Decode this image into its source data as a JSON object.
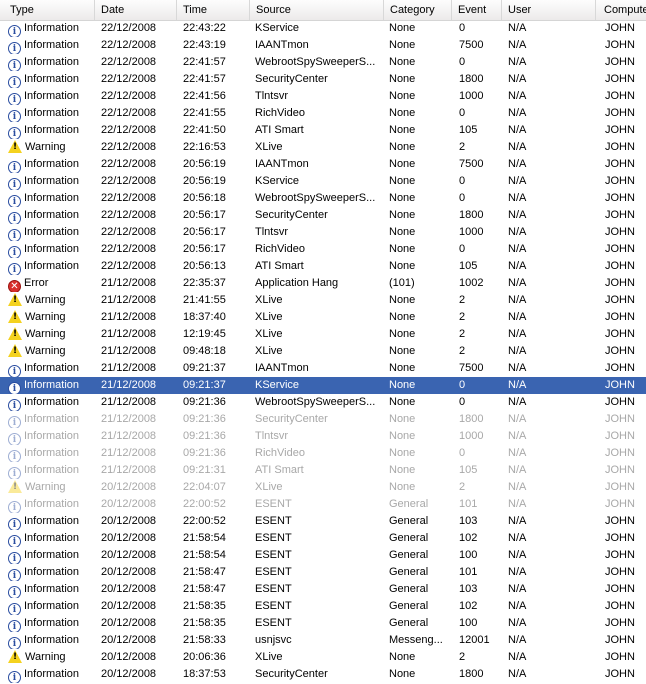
{
  "columns": {
    "type": "Type",
    "date": "Date",
    "time": "Time",
    "source": "Source",
    "category": "Category",
    "event": "Event",
    "user": "User",
    "computer": "Computer"
  },
  "icons": {
    "Information": {
      "name": "information-icon",
      "glyph": "i"
    },
    "Warning": {
      "name": "warning-icon",
      "glyph": "!"
    },
    "Error": {
      "name": "error-icon",
      "glyph": "✕"
    }
  },
  "colors": {
    "selection": "#3a64b1",
    "info_icon": "#2a4da0",
    "warning_icon": "#f4d21f",
    "error_icon": "#d8302c"
  },
  "selected_row": 21,
  "faded_rows": [
    23,
    24,
    25,
    26,
    27,
    28
  ],
  "rows": [
    {
      "type": "Information",
      "date": "22/12/2008",
      "time": "22:43:22",
      "source": "KService",
      "category": "None",
      "event": "0",
      "user": "N/A",
      "computer": "JOHN"
    },
    {
      "type": "Information",
      "date": "22/12/2008",
      "time": "22:43:19",
      "source": "IAANTmon",
      "category": "None",
      "event": "7500",
      "user": "N/A",
      "computer": "JOHN"
    },
    {
      "type": "Information",
      "date": "22/12/2008",
      "time": "22:41:57",
      "source": "WebrootSpySweeperS...",
      "category": "None",
      "event": "0",
      "user": "N/A",
      "computer": "JOHN"
    },
    {
      "type": "Information",
      "date": "22/12/2008",
      "time": "22:41:57",
      "source": "SecurityCenter",
      "category": "None",
      "event": "1800",
      "user": "N/A",
      "computer": "JOHN"
    },
    {
      "type": "Information",
      "date": "22/12/2008",
      "time": "22:41:56",
      "source": "Tlntsvr",
      "category": "None",
      "event": "1000",
      "user": "N/A",
      "computer": "JOHN"
    },
    {
      "type": "Information",
      "date": "22/12/2008",
      "time": "22:41:55",
      "source": "RichVideo",
      "category": "None",
      "event": "0",
      "user": "N/A",
      "computer": "JOHN"
    },
    {
      "type": "Information",
      "date": "22/12/2008",
      "time": "22:41:50",
      "source": "ATI Smart",
      "category": "None",
      "event": "105",
      "user": "N/A",
      "computer": "JOHN"
    },
    {
      "type": "Warning",
      "date": "22/12/2008",
      "time": "22:16:53",
      "source": "XLive",
      "category": "None",
      "event": "2",
      "user": "N/A",
      "computer": "JOHN"
    },
    {
      "type": "Information",
      "date": "22/12/2008",
      "time": "20:56:19",
      "source": "IAANTmon",
      "category": "None",
      "event": "7500",
      "user": "N/A",
      "computer": "JOHN"
    },
    {
      "type": "Information",
      "date": "22/12/2008",
      "time": "20:56:19",
      "source": "KService",
      "category": "None",
      "event": "0",
      "user": "N/A",
      "computer": "JOHN"
    },
    {
      "type": "Information",
      "date": "22/12/2008",
      "time": "20:56:18",
      "source": "WebrootSpySweeperS...",
      "category": "None",
      "event": "0",
      "user": "N/A",
      "computer": "JOHN"
    },
    {
      "type": "Information",
      "date": "22/12/2008",
      "time": "20:56:17",
      "source": "SecurityCenter",
      "category": "None",
      "event": "1800",
      "user": "N/A",
      "computer": "JOHN"
    },
    {
      "type": "Information",
      "date": "22/12/2008",
      "time": "20:56:17",
      "source": "Tlntsvr",
      "category": "None",
      "event": "1000",
      "user": "N/A",
      "computer": "JOHN"
    },
    {
      "type": "Information",
      "date": "22/12/2008",
      "time": "20:56:17",
      "source": "RichVideo",
      "category": "None",
      "event": "0",
      "user": "N/A",
      "computer": "JOHN"
    },
    {
      "type": "Information",
      "date": "22/12/2008",
      "time": "20:56:13",
      "source": "ATI Smart",
      "category": "None",
      "event": "105",
      "user": "N/A",
      "computer": "JOHN"
    },
    {
      "type": "Error",
      "date": "21/12/2008",
      "time": "22:35:37",
      "source": "Application Hang",
      "category": "(101)",
      "event": "1002",
      "user": "N/A",
      "computer": "JOHN"
    },
    {
      "type": "Warning",
      "date": "21/12/2008",
      "time": "21:41:55",
      "source": "XLive",
      "category": "None",
      "event": "2",
      "user": "N/A",
      "computer": "JOHN"
    },
    {
      "type": "Warning",
      "date": "21/12/2008",
      "time": "18:37:40",
      "source": "XLive",
      "category": "None",
      "event": "2",
      "user": "N/A",
      "computer": "JOHN"
    },
    {
      "type": "Warning",
      "date": "21/12/2008",
      "time": "12:19:45",
      "source": "XLive",
      "category": "None",
      "event": "2",
      "user": "N/A",
      "computer": "JOHN"
    },
    {
      "type": "Warning",
      "date": "21/12/2008",
      "time": "09:48:18",
      "source": "XLive",
      "category": "None",
      "event": "2",
      "user": "N/A",
      "computer": "JOHN"
    },
    {
      "type": "Information",
      "date": "21/12/2008",
      "time": "09:21:37",
      "source": "IAANTmon",
      "category": "None",
      "event": "7500",
      "user": "N/A",
      "computer": "JOHN"
    },
    {
      "type": "Information",
      "date": "21/12/2008",
      "time": "09:21:37",
      "source": "KService",
      "category": "None",
      "event": "0",
      "user": "N/A",
      "computer": "JOHN"
    },
    {
      "type": "Information",
      "date": "21/12/2008",
      "time": "09:21:36",
      "source": "WebrootSpySweeperS...",
      "category": "None",
      "event": "0",
      "user": "N/A",
      "computer": "JOHN"
    },
    {
      "type": "Information",
      "date": "21/12/2008",
      "time": "09:21:36",
      "source": "SecurityCenter",
      "category": "None",
      "event": "1800",
      "user": "N/A",
      "computer": "JOHN"
    },
    {
      "type": "Information",
      "date": "21/12/2008",
      "time": "09:21:36",
      "source": "Tlntsvr",
      "category": "None",
      "event": "1000",
      "user": "N/A",
      "computer": "JOHN"
    },
    {
      "type": "Information",
      "date": "21/12/2008",
      "time": "09:21:36",
      "source": "RichVideo",
      "category": "None",
      "event": "0",
      "user": "N/A",
      "computer": "JOHN"
    },
    {
      "type": "Information",
      "date": "21/12/2008",
      "time": "09:21:31",
      "source": "ATI Smart",
      "category": "None",
      "event": "105",
      "user": "N/A",
      "computer": "JOHN"
    },
    {
      "type": "Warning",
      "date": "20/12/2008",
      "time": "22:04:07",
      "source": "XLive",
      "category": "None",
      "event": "2",
      "user": "N/A",
      "computer": "JOHN"
    },
    {
      "type": "Information",
      "date": "20/12/2008",
      "time": "22:00:52",
      "source": "ESENT",
      "category": "General",
      "event": "101",
      "user": "N/A",
      "computer": "JOHN"
    },
    {
      "type": "Information",
      "date": "20/12/2008",
      "time": "22:00:52",
      "source": "ESENT",
      "category": "General",
      "event": "103",
      "user": "N/A",
      "computer": "JOHN"
    },
    {
      "type": "Information",
      "date": "20/12/2008",
      "time": "21:58:54",
      "source": "ESENT",
      "category": "General",
      "event": "102",
      "user": "N/A",
      "computer": "JOHN"
    },
    {
      "type": "Information",
      "date": "20/12/2008",
      "time": "21:58:54",
      "source": "ESENT",
      "category": "General",
      "event": "100",
      "user": "N/A",
      "computer": "JOHN"
    },
    {
      "type": "Information",
      "date": "20/12/2008",
      "time": "21:58:47",
      "source": "ESENT",
      "category": "General",
      "event": "101",
      "user": "N/A",
      "computer": "JOHN"
    },
    {
      "type": "Information",
      "date": "20/12/2008",
      "time": "21:58:47",
      "source": "ESENT",
      "category": "General",
      "event": "103",
      "user": "N/A",
      "computer": "JOHN"
    },
    {
      "type": "Information",
      "date": "20/12/2008",
      "time": "21:58:35",
      "source": "ESENT",
      "category": "General",
      "event": "102",
      "user": "N/A",
      "computer": "JOHN"
    },
    {
      "type": "Information",
      "date": "20/12/2008",
      "time": "21:58:35",
      "source": "ESENT",
      "category": "General",
      "event": "100",
      "user": "N/A",
      "computer": "JOHN"
    },
    {
      "type": "Information",
      "date": "20/12/2008",
      "time": "21:58:33",
      "source": "usnjsvc",
      "category": "Messeng...",
      "event": "12001",
      "user": "N/A",
      "computer": "JOHN"
    },
    {
      "type": "Warning",
      "date": "20/12/2008",
      "time": "20:06:36",
      "source": "XLive",
      "category": "None",
      "event": "2",
      "user": "N/A",
      "computer": "JOHN"
    },
    {
      "type": "Information",
      "date": "20/12/2008",
      "time": "18:37:53",
      "source": "SecurityCenter",
      "category": "None",
      "event": "1800",
      "user": "N/A",
      "computer": "JOHN"
    }
  ]
}
